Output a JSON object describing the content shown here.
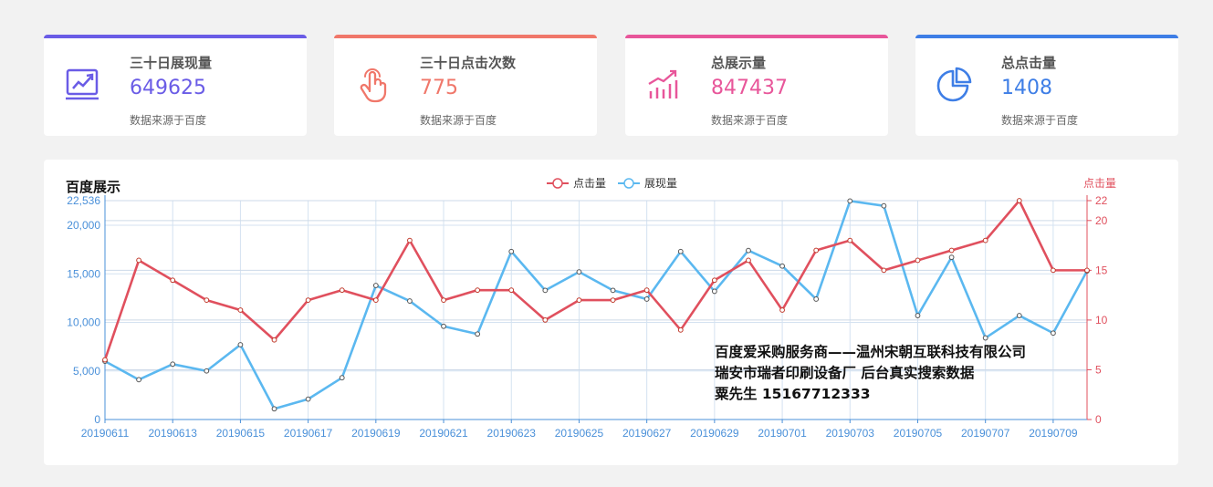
{
  "cards": [
    {
      "title": "三十日展现量",
      "value": "649625",
      "source": "数据来源于百度",
      "color": "#6a5ce6",
      "icon": "trend-chart-icon"
    },
    {
      "title": "三十日点击次数",
      "value": "775",
      "source": "数据来源于百度",
      "color": "#f0776a",
      "icon": "tap-hand-icon"
    },
    {
      "title": "总展示量",
      "value": "847437",
      "source": "数据来源于百度",
      "color": "#e8569a",
      "icon": "bar-growth-icon"
    },
    {
      "title": "总点击量",
      "value": "1408",
      "source": "数据来源于百度",
      "color": "#3e7ee6",
      "icon": "pie-chart-icon"
    }
  ],
  "panel": {
    "title": "百度展示",
    "watermark": {
      "line1": "百度爱采购服务商——温州宋朝互联科技有限公司",
      "line2": "瑞安市瑞者印刷设备厂 后台真实搜索数据",
      "line3": "粟先生 15167712333"
    }
  },
  "chart_data": {
    "type": "line",
    "x": [
      "20190611",
      "20190612",
      "20190613",
      "20190614",
      "20190615",
      "20190616",
      "20190617",
      "20190618",
      "20190619",
      "20190620",
      "20190621",
      "20190622",
      "20190623",
      "20190624",
      "20190625",
      "20190626",
      "20190627",
      "20190628",
      "20190629",
      "20190630",
      "20190701",
      "20190702",
      "20190703",
      "20190704",
      "20190705",
      "20190706",
      "20190707",
      "20190708",
      "20190709"
    ],
    "x_tick_labels": [
      "20190611",
      "20190613",
      "20190615",
      "20190617",
      "20190619",
      "20190621",
      "20190623",
      "20190625",
      "20190627",
      "20190629",
      "20190701",
      "20190703",
      "20190705",
      "20190707",
      "20190709"
    ],
    "series": [
      {
        "name": "展现量",
        "axis": "left",
        "color": "#5bb8f0",
        "values": [
          6000,
          4100,
          5700,
          5000,
          7700,
          1100,
          2100,
          4300,
          13800,
          12200,
          9600,
          8800,
          17300,
          13300,
          15200,
          13300,
          12400,
          17300,
          13200,
          17400,
          15800,
          12400,
          22500,
          22000,
          10700,
          16700,
          8400,
          10700,
          8900,
          15300
        ]
      },
      {
        "name": "点击量",
        "axis": "right",
        "color": "#e0505e",
        "values": [
          6,
          16,
          14,
          12,
          11,
          8,
          12,
          13,
          12,
          18,
          12,
          13,
          13,
          10,
          12,
          12,
          13,
          9,
          14,
          16,
          11,
          17,
          18,
          15,
          16,
          17,
          18,
          22,
          15,
          15
        ]
      }
    ],
    "left_axis": {
      "ticks": [
        "0",
        "5,000",
        "10,000",
        "15,000",
        "20,000",
        "22,536"
      ],
      "range": [
        0,
        22536
      ],
      "color": "#4a90d9"
    },
    "right_axis": {
      "label": "点击量",
      "ticks": [
        "0",
        "5",
        "10",
        "15",
        "20",
        "22"
      ],
      "range": [
        0,
        22
      ],
      "color": "#e0505e"
    },
    "legend": "top-center",
    "grid": true
  }
}
